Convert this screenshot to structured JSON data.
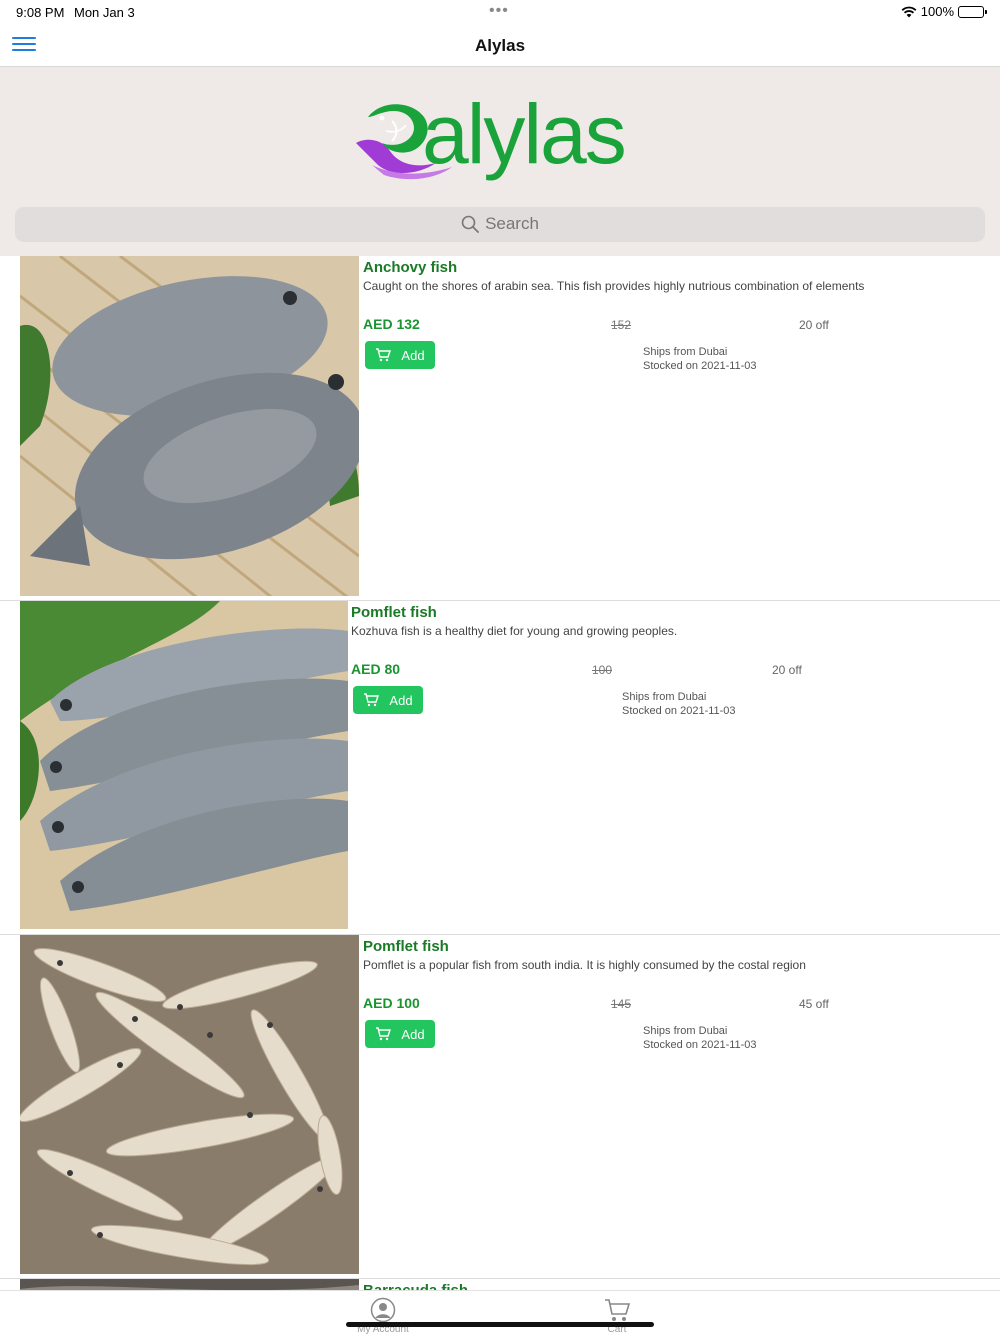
{
  "status_bar": {
    "time": "9:08 PM",
    "date": "Mon Jan 3",
    "battery": "100%",
    "icons": [
      "wifi-icon",
      "battery-icon"
    ]
  },
  "nav": {
    "title": "Alylas",
    "menu_icon": "hamburger-menu-icon"
  },
  "hero": {
    "logo_text": "alylas",
    "logo_icon": "fish-logo-icon",
    "brand_color": "#1aa33a",
    "search": {
      "placeholder": "Search",
      "icon": "search-icon"
    }
  },
  "products": [
    {
      "name": "Anchovy fish",
      "description": "Caught on the shores of arabin sea. This fish provides highly nutrious combination of elements",
      "price": "AED 132",
      "original_price": "152",
      "discount": "20 off",
      "add_label": "Add",
      "ships_from": "Ships from Dubai",
      "stocked_on": "Stocked on 2021-11-03",
      "image": "pomfret-photo"
    },
    {
      "name": "Pomflet fish",
      "description": "Kozhuva fish is a healthy diet for young and growing peoples.",
      "price": "AED 80",
      "original_price": "100",
      "discount": "20 off",
      "add_label": "Add",
      "ships_from": "Ships from Dubai",
      "stocked_on": "Stocked on 2021-11-03",
      "image": "mullet-photo"
    },
    {
      "name": "Pomflet fish",
      "description": "Pomflet is a popular fish from south india. It is highly consumed by the costal region",
      "price": "AED 100",
      "original_price": "145",
      "discount": "45 off",
      "add_label": "Add",
      "ships_from": "Ships from Dubai",
      "stocked_on": "Stocked on 2021-11-03",
      "image": "anchovy-photo"
    },
    {
      "name": "Barracuda fish",
      "image": "barracuda-photo"
    }
  ],
  "tabs": [
    {
      "label": "My Account",
      "icon": "account-icon"
    },
    {
      "label": "Cart",
      "icon": "cart-icon"
    }
  ],
  "colors": {
    "accent_blue": "#1e7ee0",
    "price_green": "#1a9430",
    "button_green": "#22c55e",
    "hero_bg": "#efe9e8"
  }
}
